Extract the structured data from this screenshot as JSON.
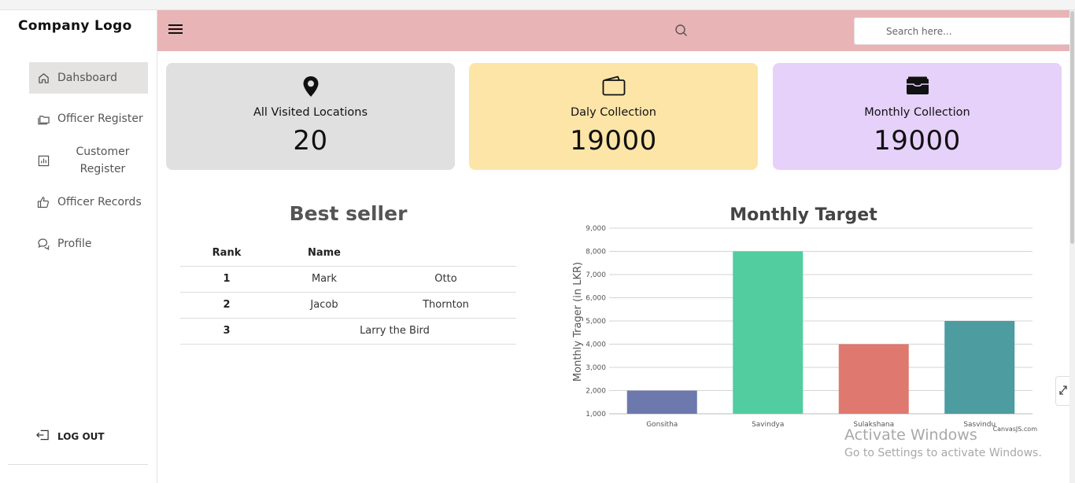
{
  "app": {
    "logo_text": "Company Logo"
  },
  "sidebar": {
    "items": [
      {
        "label": "Dahsboard",
        "icon": "home-icon"
      },
      {
        "label": "Officer Register",
        "icon": "folders-icon"
      },
      {
        "label": "Customer Register",
        "icon": "bar-chart-icon"
      },
      {
        "label": "Officer Records",
        "icon": "thumbs-up-icon"
      },
      {
        "label": "Profile",
        "icon": "chat-bubbles-icon"
      }
    ],
    "logout_label": "LOG OUT"
  },
  "header": {
    "search_placeholder": "Search here...",
    "background": "#e8b4b6"
  },
  "cards": [
    {
      "title": "All Visited Locations",
      "value": "20",
      "icon": "map-pin-icon",
      "bg": "#e0e0e0"
    },
    {
      "title": "Daly Collection",
      "value": "19000",
      "icon": "wallet-icon",
      "bg": "#fde5a8"
    },
    {
      "title": "Monthly Collection",
      "value": "19000",
      "icon": "card-wallet-icon",
      "bg": "#e6d1fa"
    }
  ],
  "best_seller": {
    "title": "Best seller",
    "headers": [
      "Rank",
      "Name",
      ""
    ],
    "rows": [
      {
        "rank": "1",
        "first": "Mark",
        "last": "Otto"
      },
      {
        "rank": "2",
        "first": "Jacob",
        "last": "Thornton"
      },
      {
        "rank": "3",
        "full": "Larry the Bird"
      }
    ]
  },
  "chart_data": {
    "type": "bar",
    "title": "Monthly Target",
    "ylabel": "Monthly Trager (in LKR)",
    "xlabel": "",
    "categories": [
      "Gonsitha",
      "Savindya",
      "Sulakshana",
      "Sasvindu"
    ],
    "values": [
      2000,
      8000,
      4000,
      5000
    ],
    "colors": [
      "#6d78ad",
      "#51cda0",
      "#df7970",
      "#4c9ca0"
    ],
    "ylim": [
      1000,
      9000
    ],
    "yticks": [
      "1,000",
      "2,000",
      "3,000",
      "4,000",
      "5,000",
      "6,000",
      "7,000",
      "8,000",
      "9,000"
    ],
    "grid": true,
    "credit": "CanvasJS.com"
  },
  "overlay": {
    "activate_title": "Activate Windows",
    "activate_sub": "Go to Settings to activate Windows."
  }
}
